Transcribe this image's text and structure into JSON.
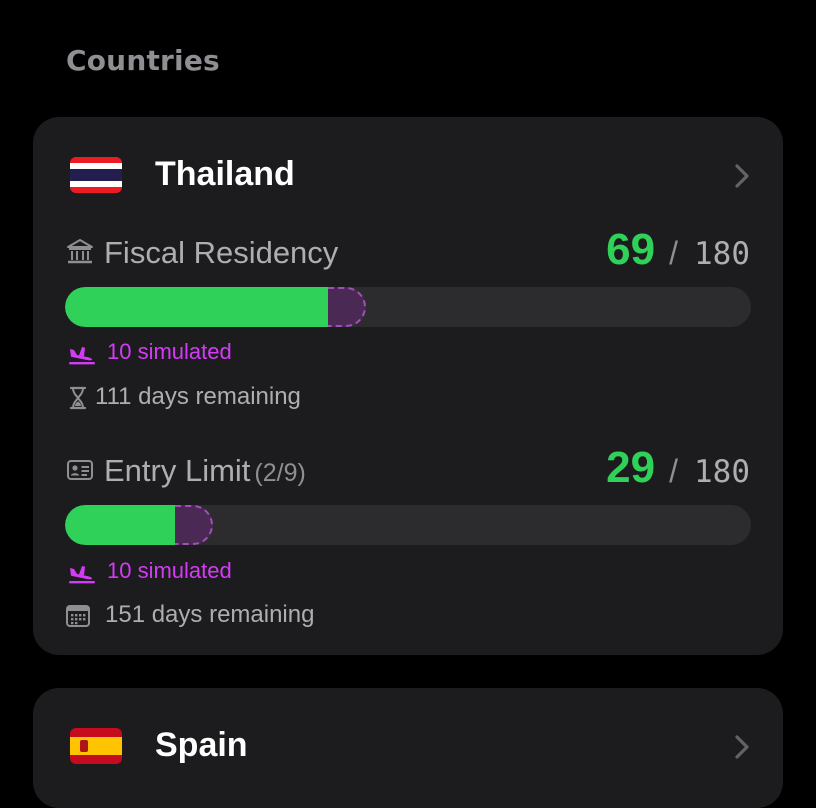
{
  "section": {
    "title": "Countries"
  },
  "countries": [
    {
      "name": "Thailand",
      "flag_icon": "thailand-flag-icon",
      "metrics": [
        {
          "label": "Fiscal Residency",
          "sublabel": "",
          "icon": "bank-icon",
          "value": "69",
          "separator": "/",
          "max": "180",
          "progress_fraction": 0.383,
          "simulated_fraction": 0.056,
          "simulated_text": "10 simulated",
          "remaining_icon": "hourglass-icon",
          "remaining_text": "111 days remaining"
        },
        {
          "label": "Entry Limit",
          "sublabel": "(2/9)",
          "icon": "id-card-icon",
          "value": "29",
          "separator": "/",
          "max": "180",
          "progress_fraction": 0.161,
          "simulated_fraction": 0.056,
          "simulated_text": "10 simulated",
          "remaining_icon": "calendar-icon",
          "remaining_text": "151 days remaining"
        }
      ]
    },
    {
      "name": "Spain",
      "flag_icon": "spain-flag-icon"
    }
  ],
  "colors": {
    "background": "#000000",
    "card": "#1c1c1e",
    "track": "#2c2c2e",
    "accent_green": "#30d158",
    "simulated_purple": "#d63af9",
    "secondary_text": "#aeaeb2"
  }
}
